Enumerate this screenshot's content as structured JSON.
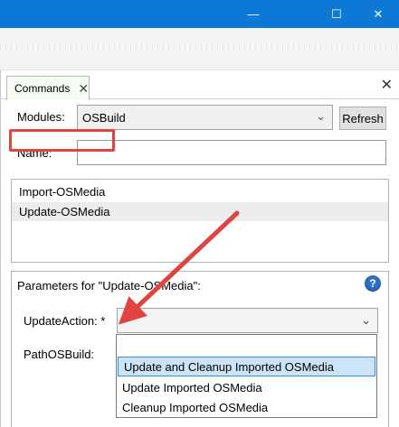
{
  "window": {
    "minimize_glyph": "—",
    "maximize_glyph": "☐",
    "close_glyph": "✕"
  },
  "pane": {
    "tab_label": "Commands",
    "tab_close_glyph": "✕",
    "pane_close_glyph": "✕"
  },
  "form": {
    "modules_label": "Modules:",
    "modules_value": "OSBuild",
    "refresh_label": "Refresh",
    "name_label": "Name:",
    "name_value": ""
  },
  "commands": [
    "Import-OSMedia",
    "Update-OSMedia"
  ],
  "parameters": {
    "title": "Parameters for \"Update-OSMedia\":",
    "help_glyph": "?",
    "update_action_label": "UpdateAction: *",
    "update_action_value": "",
    "path_label": "PathOSBuild:"
  },
  "dropdown": {
    "options": [
      "Update and Cleanup Imported OSMedia",
      "Update Imported OSMedia",
      "Cleanup Imported OSMedia"
    ],
    "highlighted_index": 0
  },
  "colors": {
    "titlebar": "#0e78d7",
    "annotation": "#e0443e",
    "selection": "#cce4f7"
  }
}
